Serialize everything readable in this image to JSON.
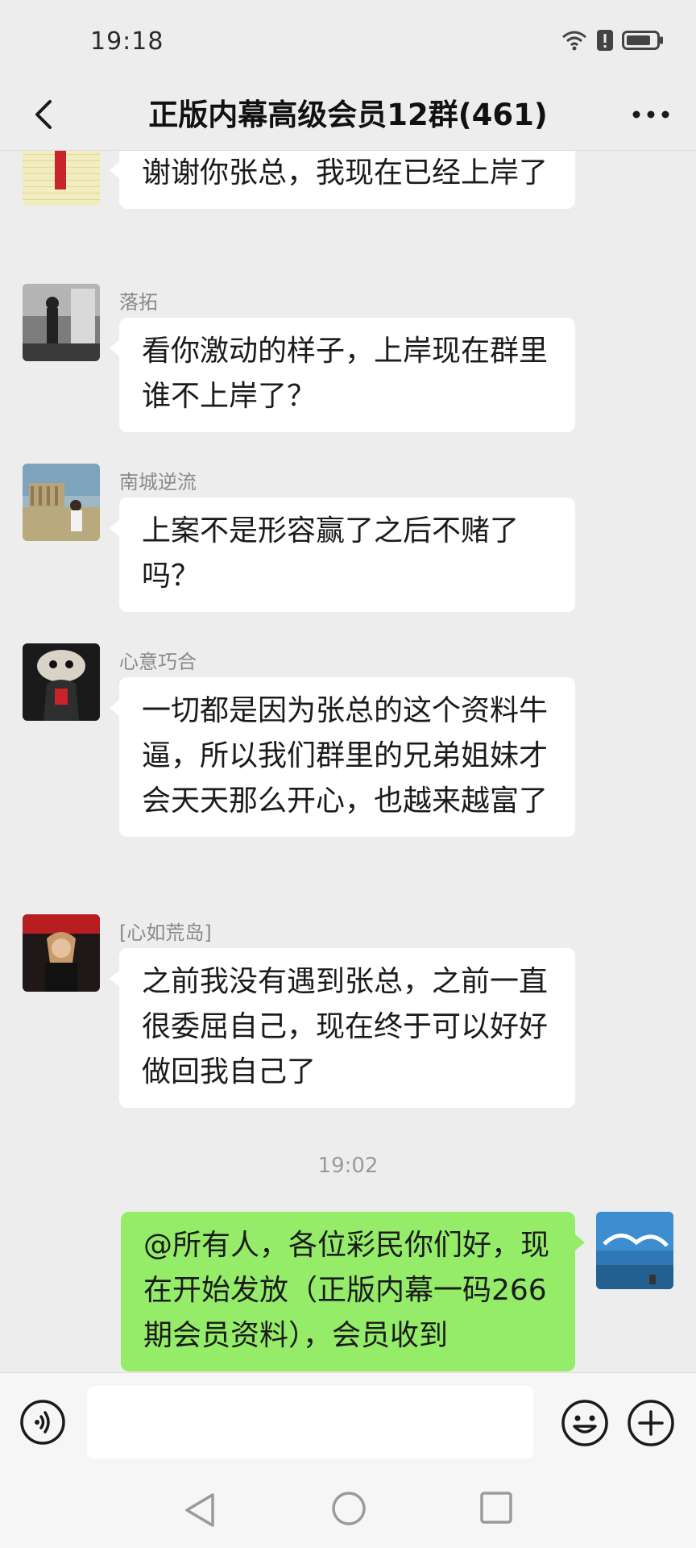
{
  "status_bar": {
    "time": "19:18"
  },
  "header": {
    "title": "正版内幕高级会员12群(461)"
  },
  "messages": [
    {
      "text": "谢谢你张总，我现在已经上岸了"
    },
    {
      "sender": "落拓",
      "text": "看你激动的样子，上岸现在群里谁不上岸了？"
    },
    {
      "sender": "南城逆流",
      "text": "上案不是形容赢了之后不赌了吗？"
    },
    {
      "sender": "心意巧合",
      "text": "一切都是因为张总的这个资料牛逼，所以我们群里的兄弟姐妹才会天天那么开心，也越来越富了"
    },
    {
      "sender": "[心如荒岛]",
      "text": "之前我没有遇到张总，之前一直很委屈自己，现在终于可以好好做回我自己了"
    }
  ],
  "timestamp": "19:02",
  "self_message": {
    "text": "@所有人，各位彩民你们好，现在开始发放（正版内幕一码266期会员资料），会员收到"
  },
  "input": {
    "value": ""
  },
  "icons": [
    "wifi-icon",
    "alert-icon",
    "battery-icon",
    "back-arrow-icon",
    "more-dots-icon",
    "voice-icon",
    "emoji-icon",
    "plus-icon",
    "nav-back-icon",
    "nav-home-icon",
    "nav-recent-icon"
  ],
  "colors": {
    "background": "#ededed",
    "bubble_other": "#ffffff",
    "bubble_self": "#95ec69",
    "name": "#8a8a8a"
  }
}
